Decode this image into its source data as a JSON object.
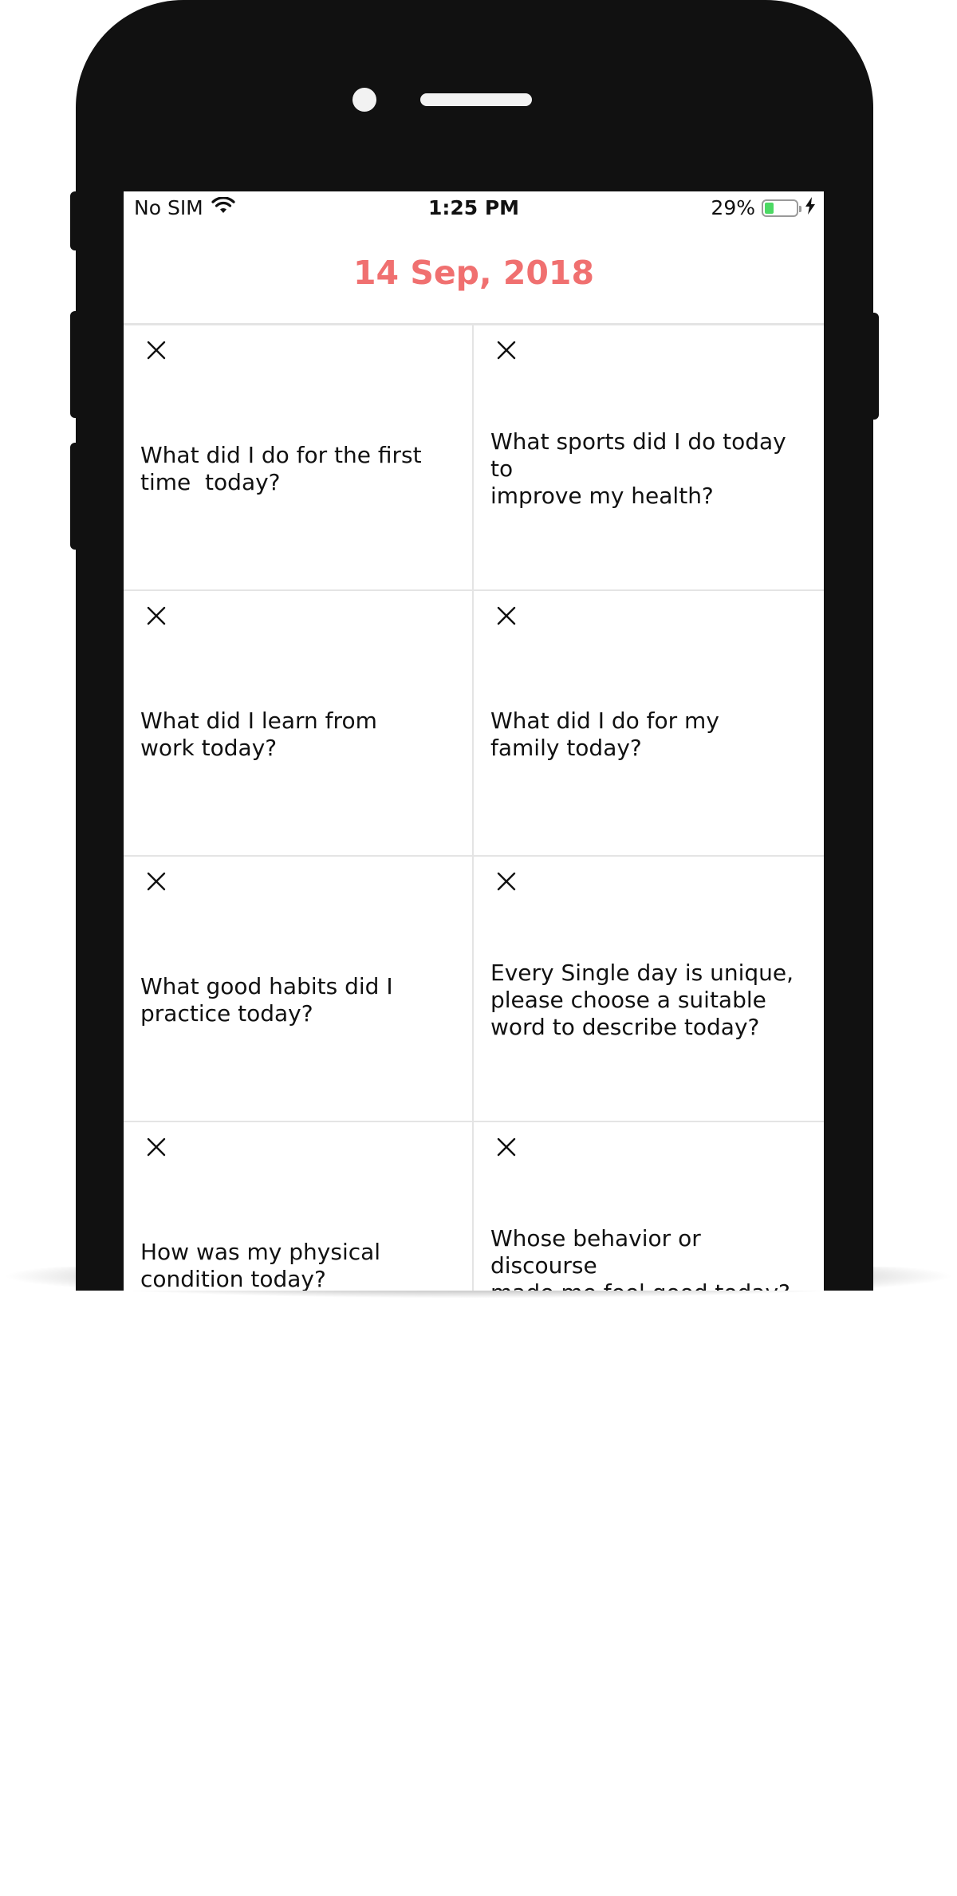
{
  "status_bar": {
    "carrier": "No SIM",
    "time": "1:25 PM",
    "battery_percent_label": "29%",
    "battery_level": 0.29,
    "wifi_icon": "wifi-icon",
    "charging_icon": "bolt-icon"
  },
  "header": {
    "title": "14 Sep, 2018",
    "title_color": "#f07070"
  },
  "cards": [
    {
      "question": "What did I do for the first\ntime  today?",
      "remove_icon": "close-icon"
    },
    {
      "question": "What sports did I do today to\nimprove my health?",
      "remove_icon": "close-icon"
    },
    {
      "question": "What did I learn from\nwork today?",
      "remove_icon": "close-icon"
    },
    {
      "question": "What did I do for my\nfamily today?",
      "remove_icon": "close-icon"
    },
    {
      "question": "What good habits did I\npractice today?",
      "remove_icon": "close-icon"
    },
    {
      "question": "Every Single day is unique,\nplease choose a suitable\nword to describe today?",
      "remove_icon": "close-icon"
    },
    {
      "question": "How was my physical\ncondition today?",
      "remove_icon": "close-icon"
    },
    {
      "question": "Whose behavior or discourse\nmade me feel good today?",
      "remove_icon": "close-icon"
    }
  ]
}
